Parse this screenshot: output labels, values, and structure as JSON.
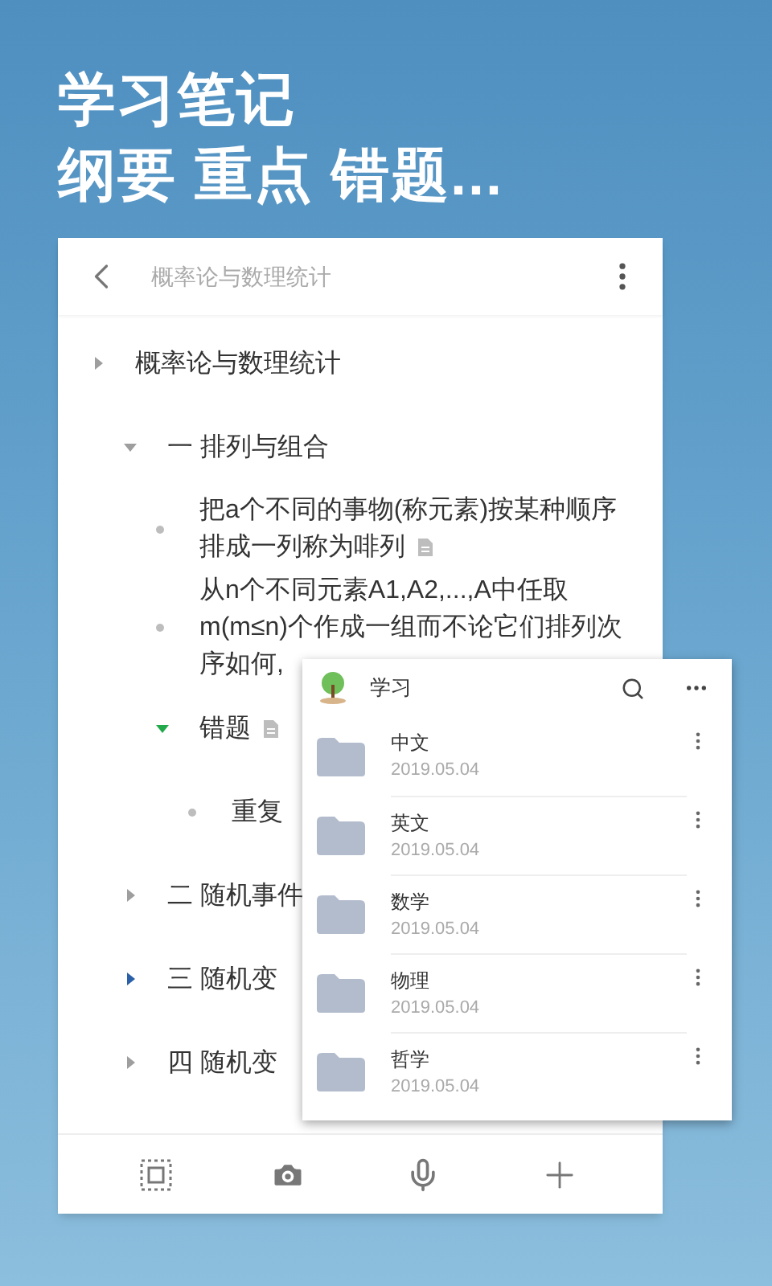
{
  "headline": [
    "学习笔记",
    "纲要 重点 错题..."
  ],
  "notebook": {
    "title": "概率论与数理统计",
    "tree": [
      {
        "kind": "branch",
        "lines": [
          "概率论与数理统计"
        ],
        "expanded": false,
        "color": "#9e9e9e",
        "children": [
          {
            "kind": "branch",
            "lines": [
              "一 排列与组合"
            ],
            "expanded": true,
            "color": "#9e9e9e",
            "children": [
              {
                "kind": "leaf",
                "lines": [
                  "把a个不同的事物(称元素)按某种顺序",
                  "排成一列称为啡列"
                ],
                "note": true
              },
              {
                "kind": "leaf",
                "lines": [
                  "从n个不同元素A1,A2,...,A中任取",
                  "m(m≤n)个作成一组而不论它们排列次",
                  "序如何,"
                ]
              },
              {
                "kind": "branch",
                "lines": [
                  "错题"
                ],
                "expanded": true,
                "color": "#22a94a",
                "note": true,
                "children": [
                  {
                    "kind": "leaf",
                    "lines": [
                      "重复"
                    ]
                  }
                ]
              }
            ]
          },
          {
            "kind": "branch",
            "lines": [
              "二 随机事件"
            ],
            "expanded": false,
            "color": "#9e9e9e"
          },
          {
            "kind": "branch",
            "lines": [
              "三 随机变"
            ],
            "expanded": false,
            "color": "#2b5fa8"
          },
          {
            "kind": "branch",
            "lines": [
              "四 随机变"
            ],
            "expanded": false,
            "color": "#9e9e9e"
          }
        ]
      }
    ]
  },
  "folder_panel": {
    "title": "学习",
    "folders": [
      {
        "name": "中文",
        "date": "2019.05.04"
      },
      {
        "name": "英文",
        "date": "2019.05.04"
      },
      {
        "name": "数学",
        "date": "2019.05.04"
      },
      {
        "name": "物理",
        "date": "2019.05.04"
      },
      {
        "name": "哲学",
        "date": "2019.05.04"
      }
    ]
  }
}
